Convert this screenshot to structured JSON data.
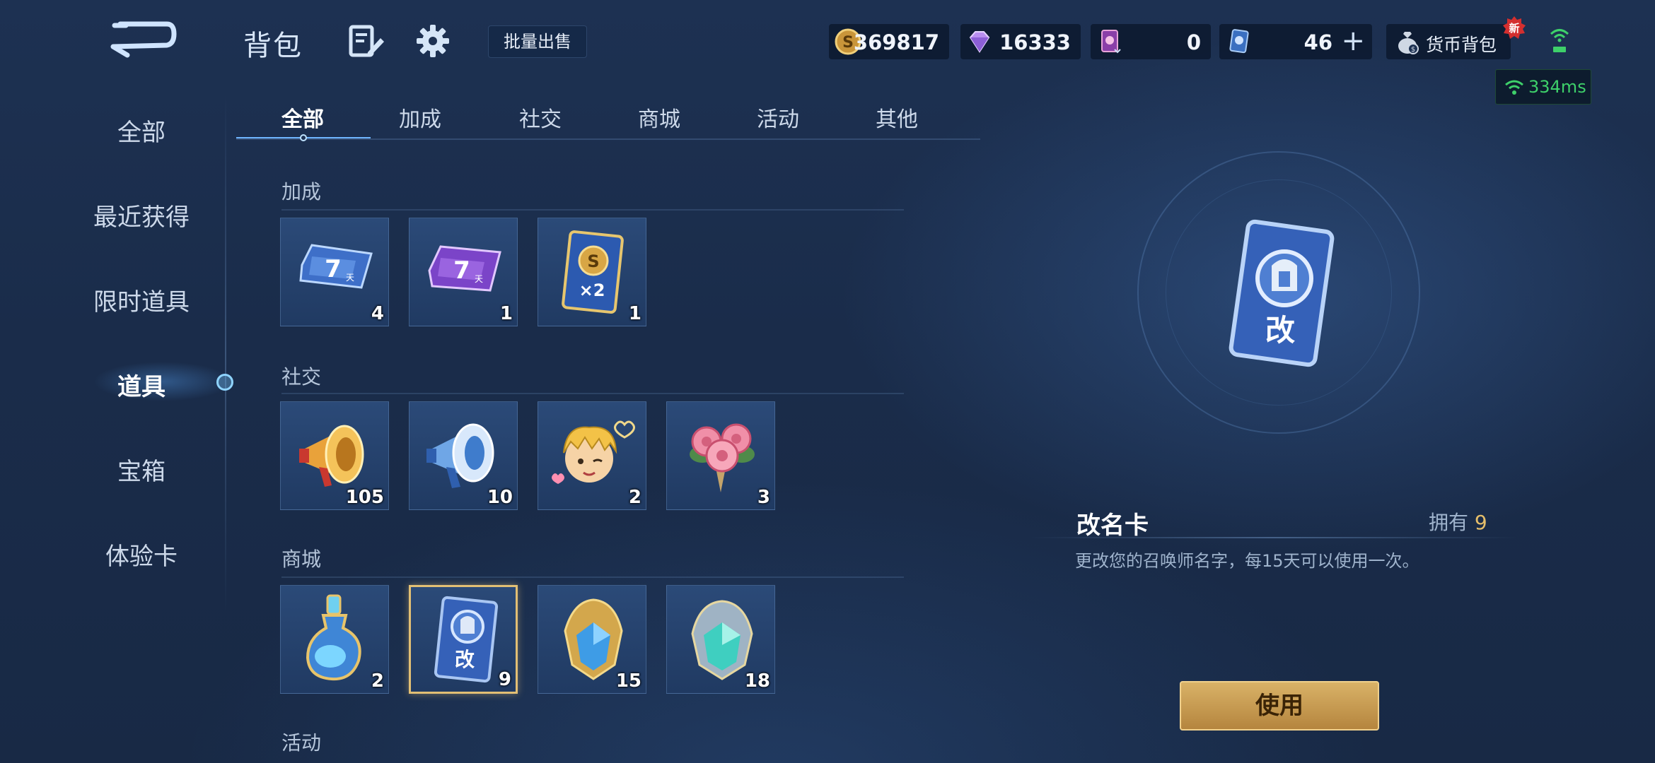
{
  "header": {
    "title": "背包",
    "bulk_sell": "批量出售",
    "currencies": [
      {
        "name": "coin",
        "value": "369817"
      },
      {
        "name": "diamond",
        "value": "16333"
      },
      {
        "name": "card-a",
        "value": "0"
      },
      {
        "name": "card-b",
        "value": "46"
      }
    ],
    "wallet_label": "货币背包",
    "new_badge": "新",
    "ping": "334ms"
  },
  "nav": {
    "items": [
      "全部",
      "最近获得",
      "限时道具",
      "道具",
      "宝箱",
      "体验卡"
    ],
    "active_index": 3
  },
  "tabs": {
    "items": [
      "全部",
      "加成",
      "社交",
      "商城",
      "活动",
      "其他"
    ],
    "active_index": 0
  },
  "sections": [
    {
      "title": "加成",
      "items": [
        {
          "icon": "blue-7day-ticket-icon",
          "count": "4"
        },
        {
          "icon": "purple-7day-ticket-icon",
          "count": "1"
        },
        {
          "icon": "gold-x2-card-icon",
          "count": "1"
        }
      ]
    },
    {
      "title": "社交",
      "items": [
        {
          "icon": "gold-megaphone-icon",
          "count": "105"
        },
        {
          "icon": "blue-megaphone-icon",
          "count": "10"
        },
        {
          "icon": "hero-emote-icon",
          "count": "2"
        },
        {
          "icon": "rose-bouquet-icon",
          "count": "3"
        }
      ]
    },
    {
      "title": "商城",
      "items": [
        {
          "icon": "potion-bottle-icon",
          "count": "2"
        },
        {
          "icon": "rename-card-icon",
          "count": "9",
          "selected": true
        },
        {
          "icon": "blue-crystal-icon",
          "count": "15"
        },
        {
          "icon": "teal-crystal-icon",
          "count": "18"
        }
      ]
    },
    {
      "title": "活动",
      "items": []
    }
  ],
  "detail": {
    "card_glyph": "改",
    "x2_text": "×2",
    "seven_day_text": "7",
    "day_text": "天",
    "name": "改名卡",
    "owned_label": "拥有",
    "owned_count": "9",
    "description": "更改您的召唤师名字，每15天可以使用一次。",
    "use_button": "使用"
  },
  "colors": {
    "accent_gold": "#e5be6a",
    "ping_green": "#3ed06a",
    "background": "#1a2c4a"
  }
}
